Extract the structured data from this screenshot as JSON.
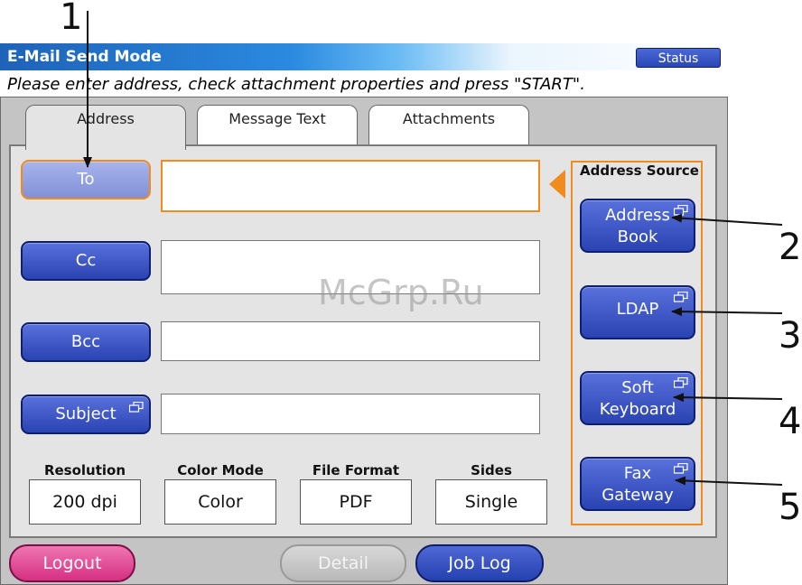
{
  "window": {
    "title": "E-Mail Send Mode",
    "status_label": "Status",
    "instruction": "Please enter address, check attachment properties and press \"START\"."
  },
  "tabs": [
    {
      "label": "Address",
      "active": true
    },
    {
      "label": "Message Text",
      "active": false
    },
    {
      "label": "Attachments",
      "active": false
    }
  ],
  "fields": {
    "to_label": "To",
    "cc_label": "Cc",
    "bcc_label": "Bcc",
    "subject_label": "Subject",
    "to_value": "",
    "cc_value": "",
    "bcc_value": "",
    "subject_value": ""
  },
  "address_source": {
    "heading": "Address Source",
    "address_book": [
      "Address",
      "Book"
    ],
    "ldap": "LDAP",
    "soft_keyboard": [
      "Soft",
      "Keyboard"
    ],
    "fax_gateway": [
      "Fax",
      "Gateway"
    ]
  },
  "params": {
    "resolution": {
      "label": "Resolution",
      "value": "200 dpi"
    },
    "color_mode": {
      "label": "Color Mode",
      "value": "Color"
    },
    "file_format": {
      "label": "File Format",
      "value": "PDF"
    },
    "sides": {
      "label": "Sides",
      "value": "Single"
    }
  },
  "bottom": {
    "logout": "Logout",
    "detail": "Detail",
    "job_log": "Job Log"
  },
  "callouts": [
    "1",
    "2",
    "3",
    "4",
    "5"
  ],
  "watermark": "McGrp.Ru",
  "colors": {
    "accent_orange": "#f08b1e",
    "button_blue": "#2a43b2",
    "logout_pink": "#d62f82",
    "title_blue": "#1e63b8"
  },
  "icons": [
    "popup-window-icon"
  ]
}
